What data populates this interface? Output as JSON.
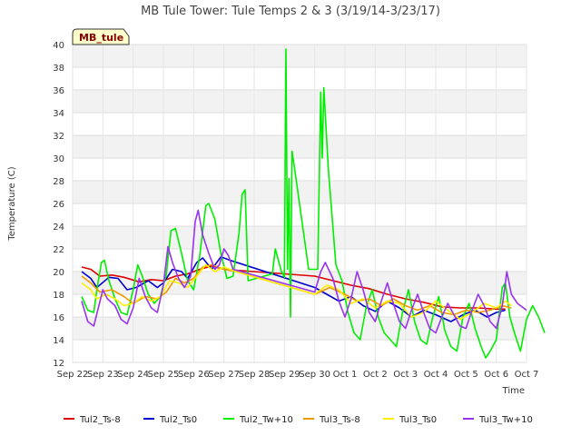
{
  "chart_data": {
    "type": "line",
    "title": "MB Tule Tower: Tule Temps 2 & 3 (3/19/14-3/23/17)",
    "xlabel": "Time",
    "ylabel": "Temperature (C)",
    "badge": "MB_tule",
    "ylim": [
      12,
      40
    ],
    "yticks": [
      12,
      14,
      16,
      18,
      20,
      22,
      24,
      26,
      28,
      30,
      32,
      34,
      36,
      38,
      40
    ],
    "xlim": [
      0,
      15
    ],
    "xticks": [
      {
        "v": 0,
        "label": "Sep 22"
      },
      {
        "v": 1,
        "label": "Sep 23"
      },
      {
        "v": 2,
        "label": "Sep 24"
      },
      {
        "v": 3,
        "label": "Sep 25"
      },
      {
        "v": 4,
        "label": "Sep 26"
      },
      {
        "v": 5,
        "label": "Sep 27"
      },
      {
        "v": 6,
        "label": "Sep 28"
      },
      {
        "v": 7,
        "label": "Sep 29"
      },
      {
        "v": 8,
        "label": "Sep 30"
      },
      {
        "v": 9,
        "label": "Oct 1"
      },
      {
        "v": 10,
        "label": "Oct 2"
      },
      {
        "v": 11,
        "label": "Oct 3"
      },
      {
        "v": 12,
        "label": "Oct 4"
      },
      {
        "v": 13,
        "label": "Oct 5"
      },
      {
        "v": 14,
        "label": "Oct 6"
      },
      {
        "v": 15,
        "label": "Oct 7"
      }
    ],
    "grid": true,
    "legend_position": "bottom",
    "series": [
      {
        "name": "Tul2_Ts-8",
        "color": "#dd0000",
        "points": [
          [
            0.3,
            20.4
          ],
          [
            0.6,
            20.2
          ],
          [
            0.9,
            19.6
          ],
          [
            1.3,
            19.7
          ],
          [
            1.7,
            19.5
          ],
          [
            2.2,
            19.1
          ],
          [
            2.6,
            19.3
          ],
          [
            3.0,
            19.2
          ],
          [
            3.4,
            19.6
          ],
          [
            3.8,
            19.8
          ],
          [
            4.2,
            20.2
          ],
          [
            4.6,
            20.5
          ],
          [
            5.0,
            20.2
          ],
          [
            6.0,
            20.0
          ],
          [
            7.0,
            19.8
          ],
          [
            8.0,
            19.6
          ],
          [
            8.6,
            19.2
          ],
          [
            9.2,
            18.8
          ],
          [
            9.8,
            18.5
          ],
          [
            10.4,
            18.0
          ],
          [
            11.0,
            17.6
          ],
          [
            11.6,
            17.3
          ],
          [
            12.2,
            16.9
          ],
          [
            12.8,
            16.8
          ],
          [
            13.4,
            16.8
          ],
          [
            14.0,
            16.7
          ],
          [
            14.3,
            16.7
          ]
        ]
      },
      {
        "name": "Tul2_Ts0",
        "color": "#0000cc",
        "points": [
          [
            0.3,
            20.0
          ],
          [
            0.6,
            19.4
          ],
          [
            0.8,
            18.6
          ],
          [
            1.2,
            19.5
          ],
          [
            1.5,
            19.4
          ],
          [
            1.8,
            18.4
          ],
          [
            2.1,
            18.6
          ],
          [
            2.5,
            19.2
          ],
          [
            2.8,
            18.6
          ],
          [
            3.0,
            19.0
          ],
          [
            3.3,
            20.2
          ],
          [
            3.6,
            20.0
          ],
          [
            3.8,
            19.4
          ],
          [
            4.1,
            20.8
          ],
          [
            4.3,
            21.2
          ],
          [
            4.6,
            20.2
          ],
          [
            4.9,
            21.3
          ],
          [
            5.2,
            21.0
          ],
          [
            8.0,
            18.6
          ],
          [
            8.4,
            18.0
          ],
          [
            8.8,
            17.4
          ],
          [
            9.2,
            17.8
          ],
          [
            9.6,
            17.0
          ],
          [
            10.0,
            16.5
          ],
          [
            10.4,
            17.4
          ],
          [
            10.8,
            16.8
          ],
          [
            11.2,
            16.0
          ],
          [
            11.6,
            16.6
          ],
          [
            12.0,
            16.2
          ],
          [
            12.5,
            15.6
          ],
          [
            12.9,
            16.2
          ],
          [
            13.3,
            16.6
          ],
          [
            13.7,
            16.0
          ],
          [
            14.0,
            16.4
          ],
          [
            14.3,
            16.6
          ]
        ]
      },
      {
        "name": "Tul2_Tw+10",
        "color": "#00ee00",
        "points": [
          [
            0.3,
            17.8
          ],
          [
            0.5,
            16.6
          ],
          [
            0.7,
            16.4
          ],
          [
            0.8,
            18.4
          ],
          [
            0.95,
            20.8
          ],
          [
            1.05,
            21.0
          ],
          [
            1.2,
            19.2
          ],
          [
            1.4,
            17.6
          ],
          [
            1.6,
            16.4
          ],
          [
            1.8,
            16.2
          ],
          [
            2.0,
            18.4
          ],
          [
            2.15,
            20.6
          ],
          [
            2.3,
            19.6
          ],
          [
            2.5,
            18.0
          ],
          [
            2.7,
            17.2
          ],
          [
            2.9,
            17.8
          ],
          [
            3.1,
            19.8
          ],
          [
            3.25,
            23.6
          ],
          [
            3.4,
            23.8
          ],
          [
            3.6,
            21.6
          ],
          [
            3.8,
            19.2
          ],
          [
            4.0,
            18.4
          ],
          [
            4.2,
            21.4
          ],
          [
            4.4,
            25.8
          ],
          [
            4.5,
            26.0
          ],
          [
            4.7,
            24.6
          ],
          [
            4.9,
            21.6
          ],
          [
            5.1,
            19.4
          ],
          [
            5.3,
            19.6
          ],
          [
            5.5,
            23.4
          ],
          [
            5.6,
            26.8
          ],
          [
            5.7,
            27.2
          ],
          [
            5.8,
            19.2
          ],
          [
            6.6,
            19.8
          ],
          [
            6.7,
            22.0
          ],
          [
            6.9,
            20.0
          ],
          [
            7.0,
            19.5
          ],
          [
            7.05,
            39.6
          ],
          [
            7.1,
            20.2
          ],
          [
            7.15,
            28.2
          ],
          [
            7.2,
            16.0
          ],
          [
            7.25,
            30.6
          ],
          [
            7.35,
            28.8
          ],
          [
            7.8,
            20.2
          ],
          [
            8.1,
            20.2
          ],
          [
            8.2,
            35.8
          ],
          [
            8.25,
            30.0
          ],
          [
            8.3,
            36.2
          ],
          [
            8.45,
            29.0
          ],
          [
            8.7,
            20.6
          ],
          [
            8.9,
            19.2
          ],
          [
            9.1,
            16.4
          ],
          [
            9.3,
            14.6
          ],
          [
            9.5,
            14.0
          ],
          [
            9.7,
            16.8
          ],
          [
            9.9,
            18.4
          ],
          [
            10.1,
            16.0
          ],
          [
            10.3,
            14.6
          ],
          [
            10.5,
            14.0
          ],
          [
            10.7,
            13.4
          ],
          [
            10.9,
            16.4
          ],
          [
            11.1,
            18.4
          ],
          [
            11.3,
            15.6
          ],
          [
            11.5,
            14.0
          ],
          [
            11.7,
            13.6
          ],
          [
            11.9,
            16.0
          ],
          [
            12.1,
            17.8
          ],
          [
            12.3,
            14.8
          ],
          [
            12.5,
            13.4
          ],
          [
            12.7,
            13.0
          ],
          [
            12.9,
            16.0
          ],
          [
            13.1,
            17.2
          ],
          [
            13.3,
            15.0
          ],
          [
            13.5,
            13.4
          ],
          [
            13.65,
            12.4
          ],
          [
            13.8,
            13.0
          ],
          [
            14.0,
            14.0
          ],
          [
            14.2,
            18.6
          ],
          [
            14.3,
            19.0
          ],
          [
            14.45,
            16.0
          ],
          [
            14.6,
            14.6
          ],
          [
            14.8,
            13.0
          ],
          [
            15.0,
            15.8
          ],
          [
            15.2,
            17.0
          ],
          [
            15.4,
            16.0
          ],
          [
            15.6,
            14.6
          ]
        ]
      },
      {
        "name": "Tul3_Ts-8",
        "color": "#ee9900",
        "points": [
          [
            0.3,
            19.6
          ],
          [
            0.6,
            19.0
          ],
          [
            0.9,
            18.2
          ],
          [
            1.3,
            18.4
          ],
          [
            1.7,
            17.8
          ],
          [
            2.0,
            17.2
          ],
          [
            2.4,
            17.8
          ],
          [
            2.8,
            17.6
          ],
          [
            3.1,
            18.2
          ],
          [
            3.4,
            19.4
          ],
          [
            3.7,
            19.0
          ],
          [
            4.0,
            19.4
          ],
          [
            4.3,
            20.4
          ],
          [
            4.6,
            20.6
          ],
          [
            5.0,
            20.2
          ],
          [
            5.4,
            20.0
          ],
          [
            8.0,
            18.0
          ],
          [
            8.5,
            18.6
          ],
          [
            9.0,
            18.0
          ],
          [
            9.4,
            17.4
          ],
          [
            9.8,
            17.6
          ],
          [
            10.2,
            17.0
          ],
          [
            10.6,
            17.6
          ],
          [
            11.0,
            17.0
          ],
          [
            11.4,
            16.6
          ],
          [
            11.8,
            17.0
          ],
          [
            12.2,
            16.4
          ],
          [
            12.6,
            16.2
          ],
          [
            13.0,
            16.6
          ],
          [
            13.4,
            16.4
          ],
          [
            13.8,
            16.6
          ],
          [
            14.2,
            17.0
          ],
          [
            14.5,
            16.8
          ]
        ]
      },
      {
        "name": "Tul3_Ts0",
        "color": "#ffee00",
        "points": [
          [
            0.3,
            19.0
          ],
          [
            0.6,
            18.4
          ],
          [
            0.8,
            17.6
          ],
          [
            1.1,
            18.0
          ],
          [
            1.4,
            17.6
          ],
          [
            1.7,
            17.0
          ],
          [
            2.0,
            17.2
          ],
          [
            2.3,
            17.8
          ],
          [
            2.6,
            17.4
          ],
          [
            2.9,
            17.8
          ],
          [
            3.2,
            19.2
          ],
          [
            3.5,
            19.0
          ],
          [
            3.8,
            18.6
          ],
          [
            4.1,
            19.6
          ],
          [
            4.4,
            20.6
          ],
          [
            4.7,
            20.0
          ],
          [
            5.0,
            20.4
          ],
          [
            5.4,
            20.0
          ],
          [
            8.0,
            18.0
          ],
          [
            8.4,
            18.8
          ],
          [
            8.8,
            18.4
          ],
          [
            9.2,
            17.2
          ],
          [
            9.6,
            17.6
          ],
          [
            10.0,
            16.8
          ],
          [
            10.4,
            17.4
          ],
          [
            10.8,
            17.2
          ],
          [
            11.2,
            16.0
          ],
          [
            11.6,
            16.4
          ],
          [
            12.0,
            17.4
          ],
          [
            12.4,
            16.6
          ],
          [
            12.8,
            15.8
          ],
          [
            13.2,
            16.4
          ],
          [
            13.6,
            17.2
          ],
          [
            14.0,
            16.8
          ],
          [
            14.3,
            17.4
          ],
          [
            14.5,
            17.0
          ]
        ]
      },
      {
        "name": "Tul3_Tw+10",
        "color": "#9933ee",
        "points": [
          [
            0.3,
            17.4
          ],
          [
            0.5,
            15.6
          ],
          [
            0.7,
            15.2
          ],
          [
            0.85,
            16.8
          ],
          [
            1.0,
            18.4
          ],
          [
            1.15,
            17.6
          ],
          [
            1.4,
            17.0
          ],
          [
            1.6,
            15.8
          ],
          [
            1.8,
            15.4
          ],
          [
            2.0,
            16.8
          ],
          [
            2.2,
            19.4
          ],
          [
            2.4,
            17.8
          ],
          [
            2.6,
            16.8
          ],
          [
            2.8,
            16.4
          ],
          [
            3.0,
            18.8
          ],
          [
            3.15,
            22.2
          ],
          [
            3.3,
            20.8
          ],
          [
            3.5,
            19.4
          ],
          [
            3.7,
            18.6
          ],
          [
            3.9,
            19.6
          ],
          [
            4.05,
            24.4
          ],
          [
            4.15,
            25.4
          ],
          [
            4.3,
            23.2
          ],
          [
            4.5,
            21.6
          ],
          [
            4.7,
            20.2
          ],
          [
            4.85,
            20.6
          ],
          [
            5.0,
            22.0
          ],
          [
            5.15,
            21.4
          ],
          [
            5.3,
            20.2
          ],
          [
            8.0,
            18.2
          ],
          [
            8.2,
            20.0
          ],
          [
            8.35,
            20.8
          ],
          [
            8.6,
            19.4
          ],
          [
            8.8,
            17.4
          ],
          [
            9.0,
            16.0
          ],
          [
            9.2,
            17.6
          ],
          [
            9.4,
            20.0
          ],
          [
            9.6,
            18.4
          ],
          [
            9.8,
            16.4
          ],
          [
            10.0,
            15.6
          ],
          [
            10.2,
            17.4
          ],
          [
            10.4,
            19.0
          ],
          [
            10.6,
            17.2
          ],
          [
            10.8,
            15.6
          ],
          [
            11.0,
            15.0
          ],
          [
            11.2,
            16.6
          ],
          [
            11.4,
            18.0
          ],
          [
            11.6,
            16.4
          ],
          [
            11.8,
            15.0
          ],
          [
            12.0,
            14.6
          ],
          [
            12.2,
            16.0
          ],
          [
            12.4,
            17.2
          ],
          [
            12.6,
            16.2
          ],
          [
            12.8,
            15.2
          ],
          [
            13.0,
            15.0
          ],
          [
            13.2,
            16.6
          ],
          [
            13.4,
            18.0
          ],
          [
            13.6,
            17.0
          ],
          [
            13.8,
            15.6
          ],
          [
            14.0,
            15.0
          ],
          [
            14.2,
            17.0
          ],
          [
            14.35,
            20.0
          ],
          [
            14.5,
            18.0
          ],
          [
            14.7,
            17.2
          ],
          [
            14.8,
            17.0
          ],
          [
            15.0,
            16.6
          ]
        ]
      }
    ]
  }
}
